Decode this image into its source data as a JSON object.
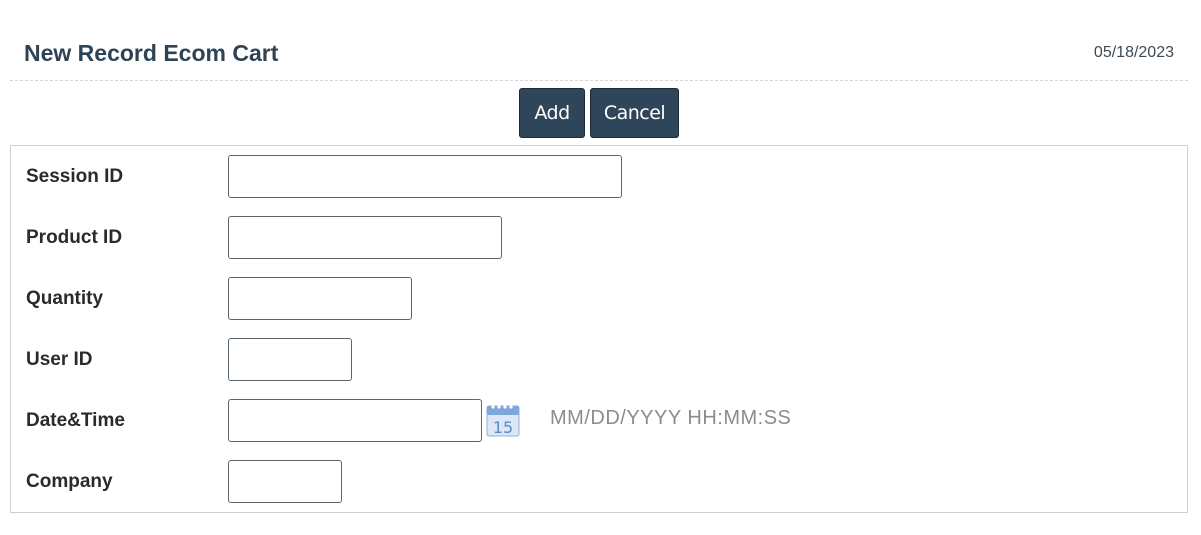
{
  "page": {
    "title": "New Record Ecom Cart",
    "date": "05/18/2023"
  },
  "toolbar": {
    "add_label": "Add",
    "cancel_label": "Cancel",
    "button_color": "#2f4559"
  },
  "form": {
    "fields": [
      {
        "label": "Session ID",
        "value": ""
      },
      {
        "label": "Product ID",
        "value": ""
      },
      {
        "label": "Quantity",
        "value": ""
      },
      {
        "label": "User ID",
        "value": ""
      },
      {
        "label": "Date&Time",
        "value": "",
        "hint": "MM/DD/YYYY HH:MM:SS",
        "icon": "calendar-icon",
        "icon_day": "15"
      },
      {
        "label": "Company",
        "value": ""
      }
    ]
  }
}
